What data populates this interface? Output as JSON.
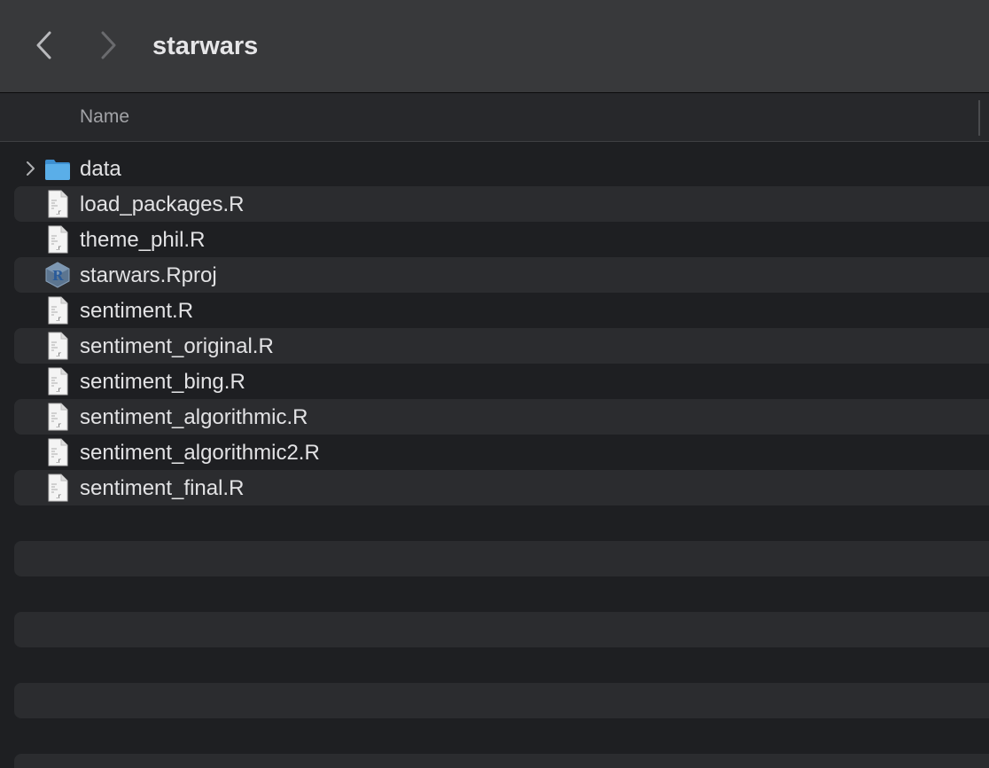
{
  "window": {
    "title": "starwars"
  },
  "columns": {
    "name_header": "Name"
  },
  "files": [
    {
      "name": "data",
      "kind": "folder",
      "icon": "folder-icon"
    },
    {
      "name": "load_packages.R",
      "kind": "r-script",
      "icon": "r-script-icon"
    },
    {
      "name": "theme_phil.R",
      "kind": "r-script",
      "icon": "r-script-icon"
    },
    {
      "name": "starwars.Rproj",
      "kind": "r-project",
      "icon": "r-project-icon"
    },
    {
      "name": "sentiment.R",
      "kind": "r-script",
      "icon": "r-script-icon"
    },
    {
      "name": "sentiment_original.R",
      "kind": "r-script",
      "icon": "r-script-icon"
    },
    {
      "name": "sentiment_bing.R",
      "kind": "r-script",
      "icon": "r-script-icon"
    },
    {
      "name": "sentiment_algorithmic.R",
      "kind": "r-script",
      "icon": "r-script-icon"
    },
    {
      "name": "sentiment_algorithmic2.R",
      "kind": "r-script",
      "icon": "r-script-icon"
    },
    {
      "name": "sentiment_final.R",
      "kind": "r-script",
      "icon": "r-script-icon"
    }
  ],
  "colors": {
    "background": "#1e1f22",
    "stripe": "#2b2c2f",
    "toolbar": "#38393b",
    "folder_blue": "#5aaee8"
  }
}
